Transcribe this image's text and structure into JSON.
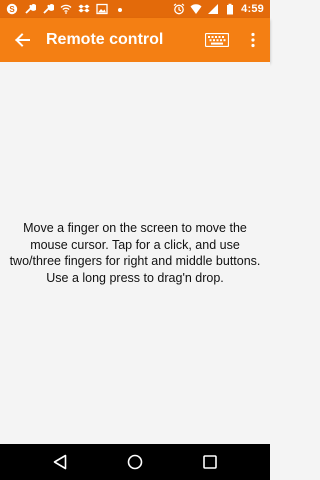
{
  "status_bar": {
    "time": "4:59",
    "left_icons": [
      "skype-icon",
      "wrench-icon",
      "wrench-icon",
      "wifi-icon",
      "dropbox-icon",
      "image-icon",
      "dot-icon"
    ],
    "right_icons": [
      "alarm-icon",
      "wifi-icon",
      "signal-icon",
      "battery-icon"
    ]
  },
  "app_bar": {
    "title": "Remote control",
    "icons": [
      "back-arrow-icon",
      "keyboard-icon",
      "more-vert-icon"
    ],
    "color": "#f47f13"
  },
  "status_color": "#e36a0a",
  "touchpad": {
    "instructions": "Move a finger on the screen to move the mouse cursor. Tap for a click, and use two/three fingers for right and middle buttons. Use a long press to drag'n drop."
  },
  "nav_bar": {
    "icons": [
      "nav-back-icon",
      "nav-home-icon",
      "nav-recents-icon"
    ]
  }
}
